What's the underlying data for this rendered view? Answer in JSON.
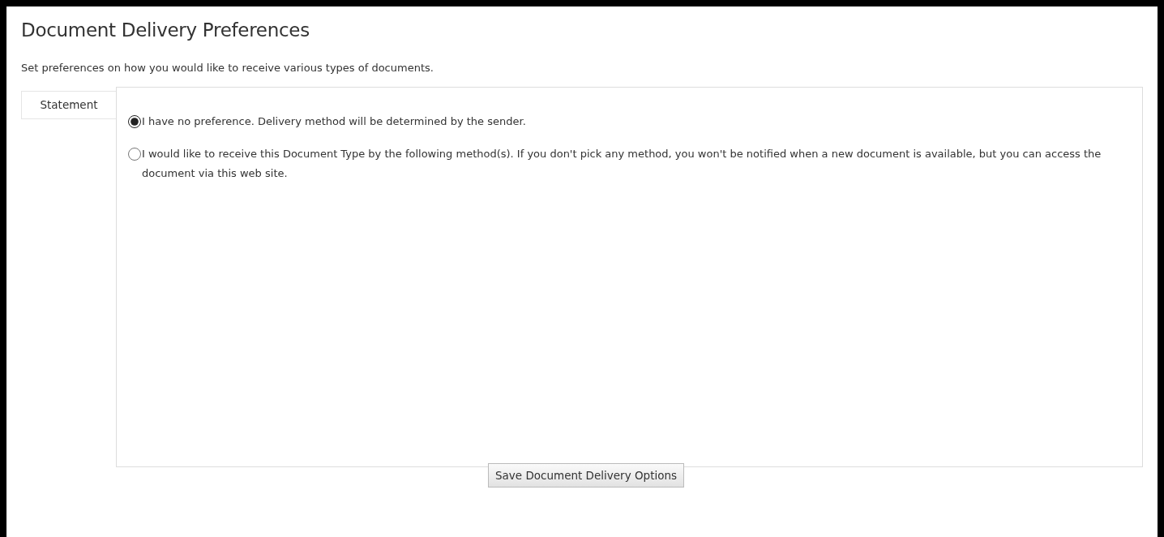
{
  "title": "Document Delivery Preferences",
  "description": "Set preferences on how you would like to receive various types of documents.",
  "tabs": [
    {
      "label": "Statement",
      "selected": true
    }
  ],
  "options": [
    {
      "label": "I have no preference. Delivery method will be determined by the sender.",
      "selected": true
    },
    {
      "label": "I would like to receive this Document Type by the following method(s). If you don't pick any method, you won't be notified when a new document is available, but you can access the document via this web site.",
      "selected": false
    }
  ],
  "save_button": "Save Document Delivery Options"
}
